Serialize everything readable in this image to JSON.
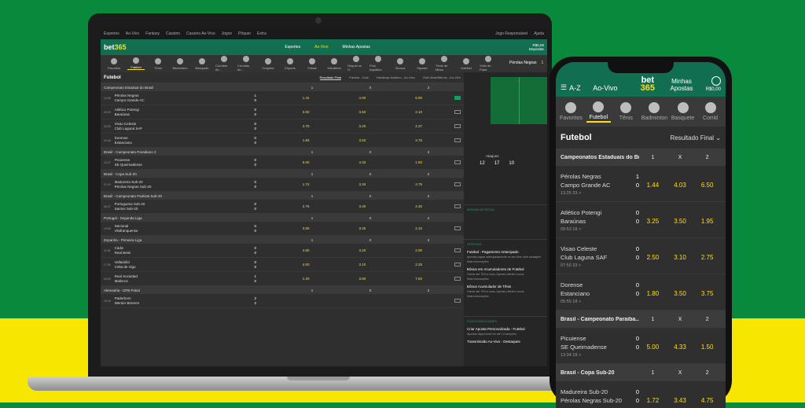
{
  "desktop": {
    "top_links": [
      "Esportes",
      "Ao-Vivo",
      "Fantasy",
      "Cassino",
      "Cassino Ao-Vivo",
      "Jogos",
      "Pôquer",
      "Extra"
    ],
    "top_right": [
      "Jogo Responsável",
      "Ajuda"
    ],
    "logo_main": "bet",
    "logo_accent": "365",
    "nav": [
      "Esportes",
      "Ao-Vivo",
      "Minhas Apostas"
    ],
    "balance": "R$0,00",
    "deposit": "Depositar",
    "sports": [
      "Favoritos",
      "Futebol",
      "Tênis",
      "Badminton",
      "Basquete",
      "Corridas de...",
      "Corridas de...",
      "Críquete",
      "Esports",
      "Futsal",
      "Handebol",
      "Hóquei no G.",
      "Pólo Aquático",
      "Sinuca",
      "Squash",
      "Tênis de Mesa",
      "Voleibol",
      "Vôlei de Praia"
    ],
    "title": "Futebol",
    "markets": [
      "Resultado Final",
      "Partida - Gols",
      "Handicap Asiático - Ao-Vivo",
      "Gols Mais/Menos - Ao-Vivo"
    ],
    "groups": [
      {
        "name": "Campeonato Estadual do Brasil",
        "rows": [
          {
            "time": "14:35",
            "t1": "Pérolas Negras",
            "t2": "Campo Grande AC",
            "s1": "1",
            "s2": "0",
            "o": [
              "1.44",
              "4.00",
              "6.50"
            ]
          },
          {
            "time": "09:29",
            "t1": "Atlético Potengi",
            "t2": "Baraúnas",
            "s1": "0",
            "s2": "0",
            "o": [
              "3.00",
              "3.50",
              "2.10"
            ]
          },
          {
            "time": "03:43",
            "t1": "Visao Celeste",
            "t2": "Club Laguna SAF",
            "s1": "0",
            "s2": "0",
            "o": [
              "2.75",
              "3.20",
              "2.37"
            ]
          },
          {
            "time": "02:44",
            "t1": "Dorense",
            "t2": "Estanciano",
            "s1": "0",
            "s2": "0",
            "o": [
              "1.83",
              "3.50",
              "3.75"
            ]
          }
        ]
      },
      {
        "name": "Brasil - Campeonato Paraibano 2",
        "rows": [
          {
            "time": "13:27",
            "t1": "Picuiense",
            "t2": "SE Queimadense",
            "s1": "0",
            "s2": "0",
            "o": [
              "5.00",
              "4.33",
              "1.50"
            ]
          }
        ]
      },
      {
        "name": "Brasil - Copa Sub-20",
        "rows": [
          {
            "time": "07:19",
            "t1": "Madureira Sub-20",
            "t2": "Pérolas Negras Sub-20",
            "s1": "0",
            "s2": "0",
            "o": [
              "1.72",
              "3.40",
              "4.75"
            ]
          }
        ]
      },
      {
        "name": "Brasil - Campeonato Paulista Sub-20",
        "rows": [
          {
            "time": "06:47",
            "t1": "Portuguesa Sub-20",
            "t2": "Santos Sub-20",
            "s1": "0",
            "s2": "0",
            "o": [
              "2.75",
              "3.40",
              "2.30"
            ]
          }
        ]
      },
      {
        "name": "Portugal - Segunda Liga",
        "rows": [
          {
            "time": "19:05",
            "t1": "Nacional",
            "t2": "Vilafranquense",
            "s1": "0",
            "s2": "0",
            "o": [
              "3.50",
              "3.25",
              "2.10"
            ]
          }
        ]
      },
      {
        "name": "Espanha - Primeira Liga",
        "rows": [
          {
            "time": "11:26",
            "t1": "Cádiz",
            "t2": "Real Betis",
            "s1": "0",
            "s2": "0",
            "o": [
              "4.50",
              "3.20",
              "2.00"
            ]
          },
          {
            "time": "17:40",
            "t1": "Valladolid",
            "t2": "Celta de Vigo",
            "s1": "0",
            "s2": "0",
            "o": [
              "4.00",
              "3.10",
              "2.25"
            ]
          },
          {
            "time": "00:03",
            "t1": "Real Sociedad",
            "t2": "Mallorca",
            "s1": "1",
            "s2": "0",
            "o": [
              "1.33",
              "3.80",
              "7.50"
            ]
          }
        ]
      },
      {
        "name": "Alemanha - DFB Pokal",
        "rows": [
          {
            "time": "19:18",
            "t1": "Paderborn",
            "t2": "Werder Bremen",
            "s1": "2",
            "s2": "2",
            "o": [
              "",
              "",
              ""
            ]
          }
        ]
      }
    ],
    "live_match": "Pérolas Negras",
    "live_score": "1",
    "stats_label": "Ataques",
    "stats": [
      "12",
      "17",
      "10"
    ],
    "minhas_apostas": "MINHAS APOSTAS",
    "ofertas": "OFERTAS",
    "offers": [
      {
        "t": "Futebol - Pagamento Antecipado",
        "d": "Apostas pagas antecipadamente se seu time abrir vantagem."
      },
      {
        "t": "Bônus em Acumuladores de Futebol",
        "d": "Ganhe até 70% a mais. Apenas clientes novos."
      },
      {
        "t": "Bônus Acumulador de Tênis",
        "d": "Ganhe até 70% a mais. Apenas clientes novos."
      }
    ],
    "funcionalidades": "FUNCIONALIDADES",
    "features": [
      {
        "t": "Criar Aposta Personalizada - Futebol",
        "d": "Apostas disponíveis em até 12 seleções."
      },
      {
        "t": "Transmissão Ao-Vivo - Destaques",
        "d": ""
      }
    ],
    "mais_info": "Mais Informações"
  },
  "mobile": {
    "az": "A-Z",
    "ao_vivo": "Ao-Vivo",
    "logo_main": "bet",
    "logo_accent": "365",
    "minhas_apostas": "Minhas Apostas",
    "balance": "R$0,00",
    "sports": [
      "Favoritos",
      "Futebol",
      "Tênis",
      "Badminton",
      "Basquete",
      "Corrid"
    ],
    "title": "Futebol",
    "market": "Resultado Final",
    "groups": [
      {
        "name": "Campeonatos Estaduais do Br...",
        "h": [
          "1",
          "X",
          "2"
        ],
        "rows": [
          {
            "t1": "Pérolas Negras",
            "t2": "Campo Grande AC",
            "time": "13:25",
            "extra": "33 >",
            "s1": "1",
            "s2": "0",
            "o": [
              "1.44",
              "4.03",
              "6.50"
            ]
          },
          {
            "t1": "Atlético Potengi",
            "t2": "Baraúnas",
            "time": "09:53",
            "extra": "18 >",
            "s1": "0",
            "s2": "0",
            "o": [
              "3.25",
              "3.50",
              "1.95"
            ]
          },
          {
            "t1": "Visao Celeste",
            "t2": "Club Laguna SAF",
            "time": "07:50",
            "extra": "33 >",
            "s1": "0",
            "s2": "0",
            "o": [
              "2.50",
              "3.10",
              "2.75"
            ]
          },
          {
            "t1": "Dorense",
            "t2": "Estanciano",
            "time": "05:55",
            "extra": "18 >",
            "s1": "0",
            "s2": "0",
            "o": [
              "1.80",
              "3.50",
              "3.75"
            ]
          }
        ]
      },
      {
        "name": "Brasil - Campeonato Paraiba...",
        "h": [
          "1",
          "X",
          "2"
        ],
        "rows": [
          {
            "t1": "Picuiense",
            "t2": "SE Queimadense",
            "time": "13:34",
            "extra": "18 >",
            "s1": "0",
            "s2": "0",
            "o": [
              "5.00",
              "4.33",
              "1.50"
            ]
          }
        ]
      },
      {
        "name": "Brasil - Copa Sub-20",
        "h": [
          "1",
          "X",
          "2"
        ],
        "rows": [
          {
            "t1": "Madureira Sub-20",
            "t2": "Pérolas Negras Sub-20",
            "time": "",
            "extra": "",
            "s1": "0",
            "s2": "0",
            "o": [
              "1.72",
              "3.43",
              "4.75"
            ]
          }
        ]
      }
    ]
  }
}
